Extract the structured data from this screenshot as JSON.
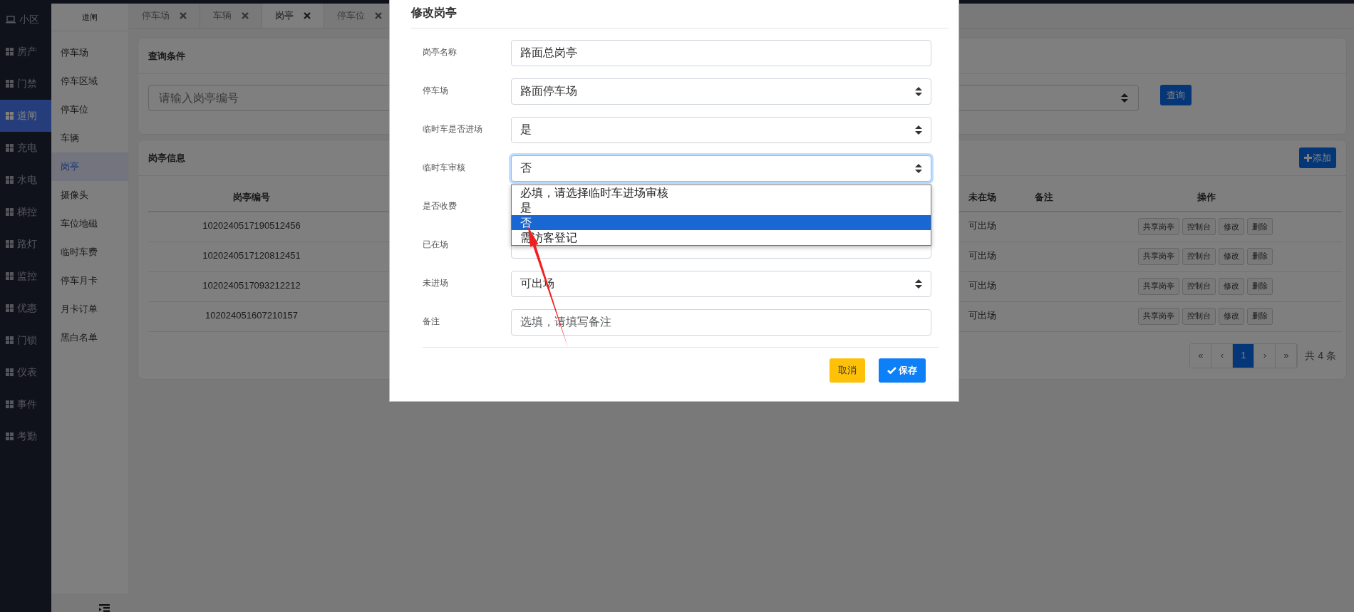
{
  "sidebar": {
    "items": [
      {
        "label": "小区",
        "kind": "laptop",
        "selected": false
      },
      {
        "label": "房产",
        "kind": "grid",
        "selected": false
      },
      {
        "label": "门禁",
        "kind": "grid",
        "selected": false
      },
      {
        "label": "道闸",
        "kind": "grid",
        "selected": true
      },
      {
        "label": "充电",
        "kind": "grid",
        "selected": false
      },
      {
        "label": "水电",
        "kind": "grid",
        "selected": false
      },
      {
        "label": "梯控",
        "kind": "grid",
        "selected": false
      },
      {
        "label": "路灯",
        "kind": "grid",
        "selected": false
      },
      {
        "label": "监控",
        "kind": "grid",
        "selected": false
      },
      {
        "label": "优惠",
        "kind": "grid",
        "selected": false
      },
      {
        "label": "门锁",
        "kind": "grid",
        "selected": false
      },
      {
        "label": "仪表",
        "kind": "grid",
        "selected": false
      },
      {
        "label": "事件",
        "kind": "grid",
        "selected": false
      },
      {
        "label": "考勤",
        "kind": "grid",
        "selected": false
      }
    ]
  },
  "submenu": {
    "title": "道闸",
    "items": [
      {
        "label": "停车场",
        "selected": false
      },
      {
        "label": "停车区域",
        "selected": false
      },
      {
        "label": "停车位",
        "selected": false
      },
      {
        "label": "车辆",
        "selected": false
      },
      {
        "label": "岗亭",
        "selected": true
      },
      {
        "label": "摄像头",
        "selected": false
      },
      {
        "label": "车位地磁",
        "selected": false
      },
      {
        "label": "临时车费",
        "selected": false
      },
      {
        "label": "停车月卡",
        "selected": false
      },
      {
        "label": "月卡订单",
        "selected": false
      },
      {
        "label": "黑白名单",
        "selected": false
      }
    ]
  },
  "tabs": [
    {
      "label": "停车场",
      "selected": false
    },
    {
      "label": "车辆",
      "selected": false
    },
    {
      "label": "岗亭",
      "selected": true
    },
    {
      "label": "停车位",
      "selected": false
    }
  ],
  "query": {
    "title": "查询条件",
    "search": {
      "placeholder": "请输入岗亭编号"
    },
    "button": "查询"
  },
  "list": {
    "title": "岗亭信息",
    "add_button": "添加",
    "columns": [
      "岗亭编号",
      "未在场",
      "备注",
      "操作"
    ],
    "rows": [
      {
        "number": "1020240517190512456",
        "not_present": "可出场",
        "actions": [
          "共享岗亭",
          "控制台",
          "修改",
          "删除"
        ]
      },
      {
        "number": "1020240517120812451",
        "not_present": "可出场",
        "actions": [
          "共享岗亭",
          "控制台",
          "修改",
          "删除"
        ]
      },
      {
        "number": "1020240517093212212",
        "not_present": "可出场",
        "actions": [
          "共享岗亭",
          "控制台",
          "修改",
          "删除"
        ]
      },
      {
        "number": "102024051607210157",
        "not_present": "可出场",
        "actions": [
          "共享岗亭",
          "控制台",
          "修改",
          "删除"
        ]
      }
    ],
    "pagination": {
      "first": "«",
      "prev": "‹",
      "pages": [
        {
          "label": "1",
          "selected": true
        }
      ],
      "next": "›",
      "last": "»",
      "total": "共 4 条"
    }
  },
  "modal": {
    "title": "修改岗亭",
    "fields": [
      {
        "label": "岗亭名称",
        "kind": "input",
        "value": "路面总岗亭",
        "focused": false
      },
      {
        "label": "停车场",
        "kind": "select",
        "value": "路面停车场",
        "focused": false
      },
      {
        "label": "临时车是否进场",
        "kind": "select",
        "value": "是",
        "focused": false
      },
      {
        "label": "临时车审核",
        "kind": "select",
        "value": "否",
        "focused": true,
        "options": [
          {
            "label": "必填，请选择临时车进场审核",
            "selected": false
          },
          {
            "label": "是",
            "selected": false
          },
          {
            "label": "否",
            "selected": true
          },
          {
            "label": "需访客登记",
            "selected": false
          }
        ]
      },
      {
        "label": "是否收费",
        "kind": "select",
        "focused": false
      },
      {
        "label": "已在场",
        "kind": "select",
        "focused": false
      },
      {
        "label": "未进场",
        "kind": "select",
        "value": "可出场",
        "focused": false
      },
      {
        "label": "备注",
        "kind": "input",
        "placeholder": "选填，请填写备注",
        "focused": false
      }
    ],
    "cancel": "取消",
    "save": "保存"
  },
  "annotations": [
    {
      "kind": "arrow"
    }
  ]
}
